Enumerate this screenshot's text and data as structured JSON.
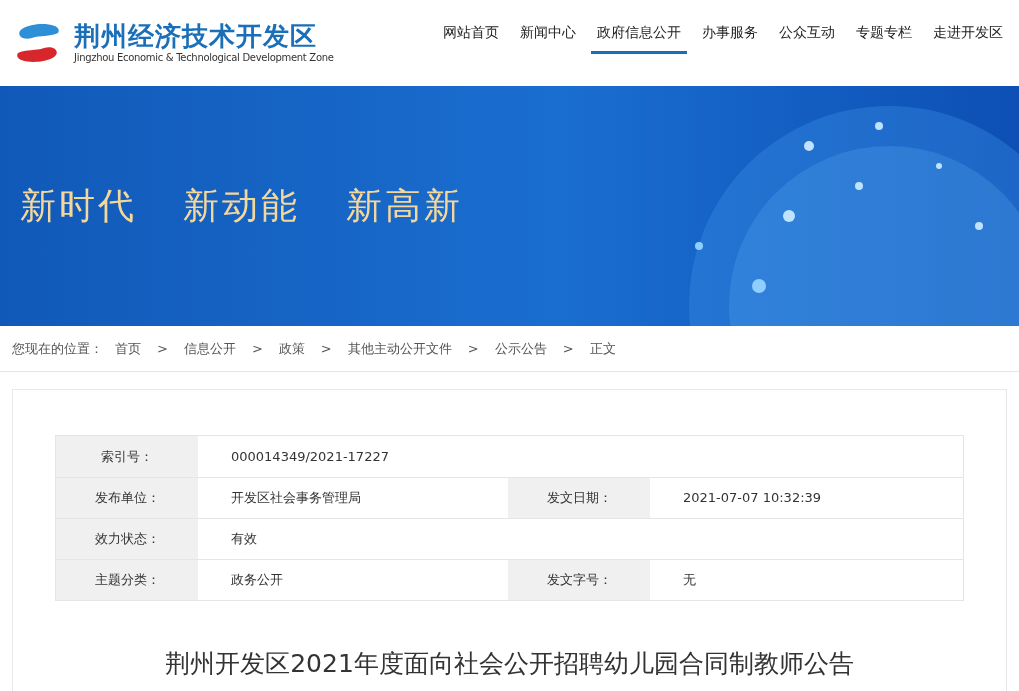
{
  "logo": {
    "title": "荆州经济技术开发区",
    "subtitle": "Jingzhou Economic & Technological Development Zone"
  },
  "nav": [
    {
      "label": "网站首页",
      "selected": false
    },
    {
      "label": "新闻中心",
      "selected": false
    },
    {
      "label": "政府信息公开",
      "selected": true
    },
    {
      "label": "办事服务",
      "selected": false
    },
    {
      "label": "公众互动",
      "selected": false
    },
    {
      "label": "专题专栏",
      "selected": false
    },
    {
      "label": "走进开发区",
      "selected": false
    }
  ],
  "banner": {
    "slogans": [
      "新时代",
      "新动能",
      "新高新"
    ]
  },
  "breadcrumb": [
    {
      "kind": "label",
      "text": "您现在的位置："
    },
    {
      "kind": "link",
      "text": "首页"
    },
    {
      "kind": "separator",
      "text": ">"
    },
    {
      "kind": "link",
      "text": "信息公开"
    },
    {
      "kind": "separator",
      "text": ">"
    },
    {
      "kind": "link",
      "text": "政策"
    },
    {
      "kind": "separator",
      "text": ">"
    },
    {
      "kind": "link",
      "text": "其他主动公开文件"
    },
    {
      "kind": "separator",
      "text": ">"
    },
    {
      "kind": "link",
      "text": "公示公告"
    },
    {
      "kind": "separator",
      "text": ">"
    },
    {
      "kind": "link",
      "text": "正文"
    }
  ],
  "meta": [
    {
      "cells": [
        {
          "label": "索引号：",
          "value": "000014349/2021-17227"
        }
      ]
    },
    {
      "cells": [
        {
          "label": "发布单位：",
          "value": "开发区社会事务管理局"
        },
        {
          "label": "发文日期：",
          "value": "2021-07-07 10:32:39"
        }
      ]
    },
    {
      "cells": [
        {
          "label": "效力状态：",
          "value": "有效"
        }
      ]
    },
    {
      "cells": [
        {
          "label": "主题分类：",
          "value": "政务公开"
        },
        {
          "label": "发文字号：",
          "value": "无"
        }
      ]
    }
  ],
  "title": "荆州开发区2021年度面向社会公开招聘幼儿园合同制教师公告"
}
